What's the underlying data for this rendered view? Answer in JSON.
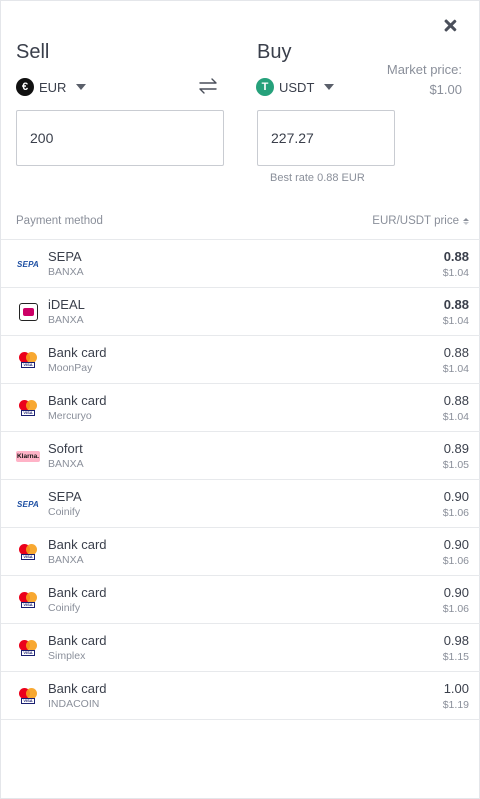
{
  "sell": {
    "title": "Sell",
    "currency": "EUR",
    "currency_icon": "euro-icon",
    "amount": "200"
  },
  "buy": {
    "title": "Buy",
    "currency": "USDT",
    "currency_icon": "tether-icon",
    "amount": "227.27",
    "best_rate": "Best rate 0.88 EUR"
  },
  "market": {
    "label": "Market price:",
    "value": "$1.00"
  },
  "table": {
    "col_method": "Payment method",
    "col_price": "EUR/USDT price",
    "rows": [
      {
        "name": "SEPA",
        "provider": "BANXA",
        "price": "0.88",
        "price_usd": "$1.04",
        "logo": "sepa",
        "best": true
      },
      {
        "name": "iDEAL",
        "provider": "BANXA",
        "price": "0.88",
        "price_usd": "$1.04",
        "logo": "ideal",
        "best": true
      },
      {
        "name": "Bank card",
        "provider": "MoonPay",
        "price": "0.88",
        "price_usd": "$1.04",
        "logo": "card",
        "best": false
      },
      {
        "name": "Bank card",
        "provider": "Mercuryo",
        "price": "0.88",
        "price_usd": "$1.04",
        "logo": "card",
        "best": false
      },
      {
        "name": "Sofort",
        "provider": "BANXA",
        "price": "0.89",
        "price_usd": "$1.05",
        "logo": "klarna",
        "best": false
      },
      {
        "name": "SEPA",
        "provider": "Coinify",
        "price": "0.90",
        "price_usd": "$1.06",
        "logo": "sepa",
        "best": false
      },
      {
        "name": "Bank card",
        "provider": "BANXA",
        "price": "0.90",
        "price_usd": "$1.06",
        "logo": "card",
        "best": false
      },
      {
        "name": "Bank card",
        "provider": "Coinify",
        "price": "0.90",
        "price_usd": "$1.06",
        "logo": "card",
        "best": false
      },
      {
        "name": "Bank card",
        "provider": "Simplex",
        "price": "0.98",
        "price_usd": "$1.15",
        "logo": "card",
        "best": false
      },
      {
        "name": "Bank card",
        "provider": "INDACOIN",
        "price": "1.00",
        "price_usd": "$1.19",
        "logo": "card",
        "best": false
      }
    ]
  },
  "logos": {
    "sepa_text": "SEPA",
    "sepa_mid": "€",
    "klarna_text": "Klarna.",
    "visa_text": "VISA",
    "eur_symbol": "€",
    "usdt_symbol": "T"
  },
  "colors": {
    "usdt": "#26a17b",
    "ideal": "#cc0066",
    "klarna": "#ffb3c7",
    "sepa": "#1d4fa3"
  }
}
